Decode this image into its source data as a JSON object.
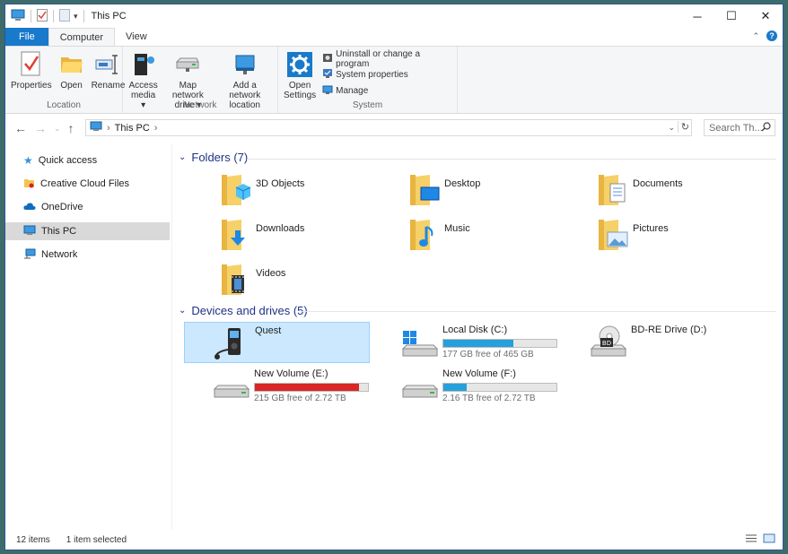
{
  "window": {
    "title": "This PC",
    "controls": {
      "minimize": "─",
      "maximize": "☐",
      "close": "✕"
    }
  },
  "ribbon": {
    "tabs": [
      {
        "label": "File"
      },
      {
        "label": "Computer"
      },
      {
        "label": "View"
      }
    ],
    "groups": {
      "location": {
        "label": "Location",
        "buttons": [
          {
            "label": "Properties"
          },
          {
            "label": "Open"
          },
          {
            "label": "Rename"
          }
        ]
      },
      "network": {
        "label": "Network",
        "buttons": [
          {
            "line1": "Access",
            "line2": "media ▾"
          },
          {
            "line1": "Map network",
            "line2": "drive ▾"
          },
          {
            "line1": "Add a network",
            "line2": "location"
          }
        ]
      },
      "system": {
        "label": "System",
        "open_settings": {
          "line1": "Open",
          "line2": "Settings"
        },
        "small_buttons": [
          {
            "label": "Uninstall or change a program"
          },
          {
            "label": "System properties"
          },
          {
            "label": "Manage"
          }
        ]
      }
    }
  },
  "address": {
    "crumbs": [
      {
        "label": "This PC"
      }
    ],
    "separator": "›",
    "search_placeholder": "Search Th..."
  },
  "sidebar": {
    "items": [
      {
        "label": "Quick access"
      },
      {
        "label": "Creative Cloud Files"
      },
      {
        "label": "OneDrive"
      },
      {
        "label": "This PC"
      },
      {
        "label": "Network"
      }
    ],
    "selected": "This PC"
  },
  "folders_section": {
    "title": "Folders (7)",
    "folders": [
      {
        "name": "3D Objects"
      },
      {
        "name": "Desktop"
      },
      {
        "name": "Documents"
      },
      {
        "name": "Downloads"
      },
      {
        "name": "Music"
      },
      {
        "name": "Pictures"
      },
      {
        "name": "Videos"
      }
    ]
  },
  "drives_section": {
    "title": "Devices and drives (5)",
    "drives": [
      {
        "name": "Quest",
        "free": "",
        "used_fraction": null,
        "selected": true
      },
      {
        "name": "Local Disk (C:)",
        "free": "177 GB free of 465 GB",
        "used_fraction": 0.62
      },
      {
        "name": "BD-RE Drive (D:)",
        "free": "",
        "used_fraction": null
      },
      {
        "name": "New Volume (E:)",
        "free": "215 GB free of 2.72 TB",
        "used_fraction": 0.92
      },
      {
        "name": "New Volume (F:)",
        "free": "2.16 TB free of 2.72 TB",
        "used_fraction": 0.21
      }
    ]
  },
  "status": {
    "item_count": "12 items",
    "selection": "1 item selected"
  },
  "colors": {
    "accent": "#1979ca",
    "drive_bar": "#26a0da",
    "drive_bar_full": "#da2626",
    "selection": "#cce8ff",
    "section_title": "#1e3287"
  }
}
